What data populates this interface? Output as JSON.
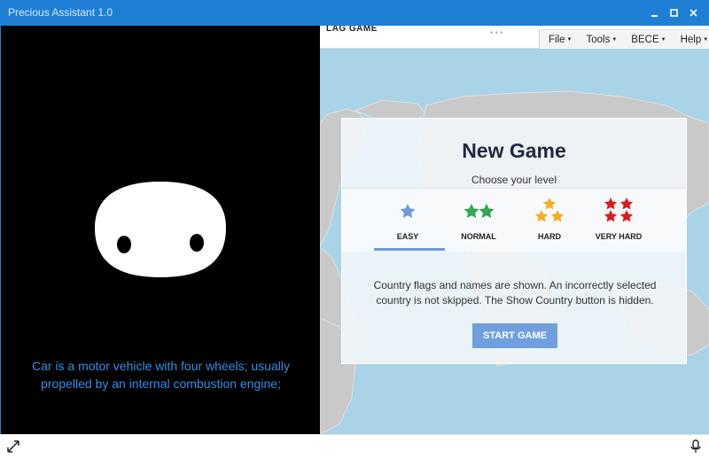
{
  "window": {
    "title": "Precious Assistant 1.0",
    "controls": [
      "minimize-icon",
      "maximize-icon",
      "close-icon"
    ]
  },
  "assistant": {
    "caption": "Car is a motor vehicle with four wheels; usually propelled by an internal combustion engine;"
  },
  "game": {
    "topbar_title": "LAG GAME",
    "menu": [
      {
        "label": "File"
      },
      {
        "label": "Tools"
      },
      {
        "label": "BECE"
      },
      {
        "label": "Help"
      }
    ],
    "dialog": {
      "title": "New Game",
      "subtitle": "Choose your level",
      "levels": [
        {
          "label": "EASY",
          "stars": 1,
          "color": "#6f9bd9",
          "selected": true
        },
        {
          "label": "NORMAL",
          "stars": 2,
          "color": "#2fa84f"
        },
        {
          "label": "HARD",
          "stars": 3,
          "color": "#f2b01e"
        },
        {
          "label": "VERY HARD",
          "stars": 4,
          "color": "#e0191c"
        }
      ],
      "description": "Country flags and names are shown. An incorrectly selected country is not skipped. The Show Country button is hidden.",
      "start_button": "START GAME"
    }
  },
  "statusbar": {
    "left_icon": "expand-icon",
    "right_icon": "microphone-icon"
  },
  "colors": {
    "titlebar": "#1e7fd4",
    "caption": "#2e8fe6",
    "ocean": "#a9d3e6",
    "start_button": "#6fa0dd"
  }
}
